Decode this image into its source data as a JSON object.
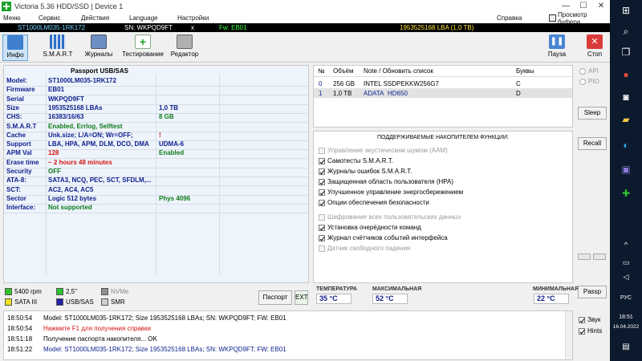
{
  "window": {
    "title": "Victoria 5.36 HDD/SSD | Device 1",
    "min": "—",
    "max": "☐",
    "close": "✕"
  },
  "menu": {
    "items": [
      "Меню",
      "Сервис",
      "Действия",
      "Language",
      "Настройки"
    ],
    "help": "Справка",
    "viewer": "Просмотр буфера"
  },
  "drive_bar": {
    "model": "ST1000LM035-1RK172",
    "sn": "SN: WKPQD9FT",
    "x": "x",
    "fw": "Fw: EB01",
    "capacity": "1953525168 LBA (1,0 TB)"
  },
  "toolbar": {
    "buttons": [
      "Инфо",
      "S.M.A.R.T",
      "Журналы",
      "Тестирование",
      "Редактор"
    ],
    "pause": "Пауза",
    "stop": "Стоп"
  },
  "passport": {
    "title": "Passport USB/SAS",
    "rows": [
      {
        "label": "Model:",
        "v1": "ST1000LM035-1RK172",
        "v2": ""
      },
      {
        "label": "Firmware",
        "v1": "EB01",
        "v2": ""
      },
      {
        "label": "Serial",
        "v1": "WKPQD9FT",
        "v2": ""
      },
      {
        "label": "Size",
        "v1": "1953525168 LBAs",
        "v2": "1,0 TB"
      },
      {
        "label": "CHS:",
        "v1": "16383/16/63",
        "v2": "8 GB"
      },
      {
        "label": "S.M.A.R.T",
        "v1": "Enabled, Errlog, Selftest",
        "v2": ""
      },
      {
        "label": "Cache",
        "v1": "Unk.size; L/A=ON; Wr=OFF;",
        "v2": "!"
      },
      {
        "label": "Support",
        "v1": "LBA, HPA, APM, DLM, DCO, DMA",
        "v2": "UDMA-6"
      },
      {
        "label": "APM Val",
        "v1": "128",
        "v2": "Enabled"
      },
      {
        "label": "Erase time",
        "v1": "~ 2 hours 48 minutes",
        "v2": ""
      },
      {
        "label": "Security",
        "v1": "OFF",
        "v2": ""
      },
      {
        "label": "ATA-8:",
        "v1": "SATA3, NCQ, PEC, SCT, SFDLM,...",
        "v2": ""
      },
      {
        "label": "SCT:",
        "v1": "AC2, AC4, AC5",
        "v2": ""
      },
      {
        "label": "Sector",
        "v1": "Logic 512 bytes",
        "v2": "Phys 4096"
      },
      {
        "label": "Interface:",
        "v1": "Not supported",
        "v2": ""
      }
    ]
  },
  "legend": {
    "items": [
      "5400 rpm",
      "2,5\"",
      "NVMe",
      "SATA III",
      "USB/SAS",
      "SMR"
    ],
    "colors": [
      "#2fc42f",
      "#2fc42f",
      "#909090",
      "#f0e020",
      "#2222aa",
      "#d0d0d0"
    ],
    "passport_btn": "Паспорт",
    "ext_btn": "EXT"
  },
  "drives": {
    "headers": [
      "№",
      "Объём",
      "Note / Обновить список",
      "Буквы"
    ],
    "rows": [
      {
        "n": "0",
        "size": "256 GB",
        "note": "INTEL SSDPEKKW256G7",
        "letter": "C"
      },
      {
        "n": "1",
        "size": "1,0 TB",
        "note": "ADATA",
        "note2": "HD650",
        "letter": "D"
      }
    ]
  },
  "features": {
    "title": "ПОДДЕРЖИВАЕМЫЕ НАКОПИТЕЛЕМ ФУНКЦИИ:",
    "items": [
      {
        "label": "Управление акустическим шумом (AAM)"
      },
      {
        "label": "Самотесты S.M.A.R.T."
      },
      {
        "label": "Журналы ошибок S.M.A.R.T."
      },
      {
        "label": "Защищенная область пользователя (HPA)"
      },
      {
        "label": "Улучшенное управление энергосбережением"
      },
      {
        "label": "Опции обеспечения безопасности"
      },
      {
        "label": "Шифрование всех пользовательских данных"
      },
      {
        "label": "Установка очерёдности команд"
      },
      {
        "label": "Журнал счётчиков событий интерфейса"
      },
      {
        "label": "Датчик свободного падения"
      }
    ]
  },
  "temps": {
    "temp_label": "ТЕМПЕРАТУРА",
    "temp_value": "35 °C",
    "max_label": "МАКСИМАЛЬНАЯ",
    "max_value": "52 °C",
    "min_label": "МИНИМАЛЬНАЯ",
    "min_value": "22 °C"
  },
  "side": {
    "api": "API",
    "pio": "PIO",
    "sleep": "Sleep",
    "recall": "Recall",
    "passp": "Passp"
  },
  "log": {
    "lines": [
      {
        "time": "18:50:54",
        "msg": "Model: ST1000LM035-1RK172; Size 1953525168 LBAs; SN: WKPQD9FT; FW: EB01"
      },
      {
        "time": "18:50:54",
        "msg": "Нажмите F1 для получения справки"
      },
      {
        "time": "18:51:18",
        "msg": "Получение паспорта накопителя... OK"
      },
      {
        "time": "18:51:22",
        "msg": "Model: ST1000LM035-1RK172; Size 1953525168 LBAs; SN: WKPQD9FT; FW: EB01"
      }
    ],
    "sound": "Звук",
    "hints": "Hints"
  },
  "taskbar": {
    "lang": "РУС",
    "time": "18:51",
    "date": "16.04.2022"
  }
}
